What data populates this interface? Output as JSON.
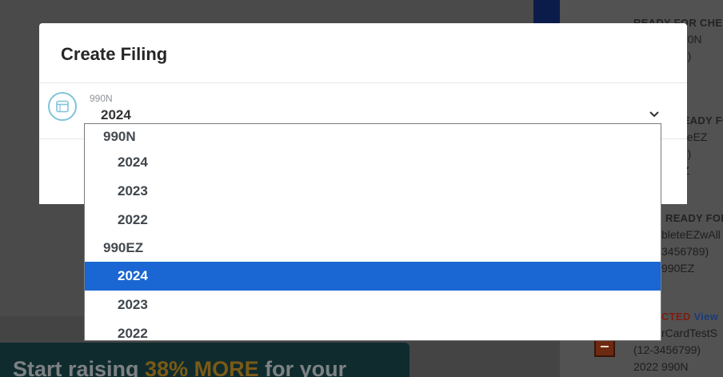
{
  "background": {
    "right_panel": [
      {
        "status": "READY FOR CHE",
        "lines": [
          "990N",
          "78)",
          "N"
        ]
      },
      {
        "status": "READY FOR",
        "lines": [
          "leteEZ",
          "99)",
          "EZ"
        ]
      },
      {
        "status": "READY FOR",
        "lines": [
          "bleteEZwAll",
          "3456789)",
          "990EZ"
        ]
      },
      {
        "status": "CTED",
        "view": "View",
        "lines": [
          "rCardTestS",
          "(12-3456799)",
          "2022 990N"
        ]
      }
    ],
    "banner": {
      "prefix": "Start raising ",
      "accent": "38% MORE",
      "suffix": " for your"
    }
  },
  "modal": {
    "title": "Create Filing",
    "select": {
      "label": "990N",
      "value": "2024",
      "icon": "window-icon"
    }
  },
  "dropdown": {
    "groups": [
      {
        "label": "990N",
        "options": [
          "2024",
          "2023",
          "2022"
        ]
      },
      {
        "label": "990EZ",
        "options": [
          "2024",
          "2023",
          "2022"
        ]
      }
    ],
    "selected": {
      "group": "990EZ",
      "option": "2024"
    }
  },
  "colors": {
    "accent": "#1a66d2",
    "icon_ring": "#7fc4d9",
    "overlay": "#4a4a4a"
  }
}
